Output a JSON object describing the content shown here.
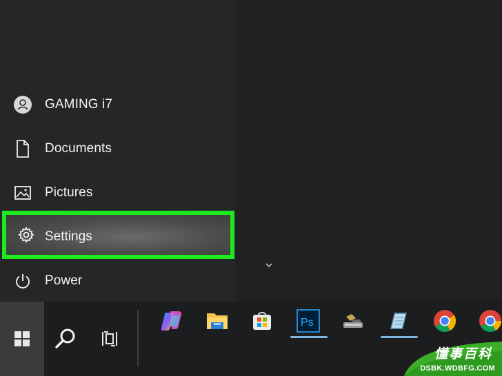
{
  "start_menu": {
    "items": [
      {
        "label": "GAMING i7",
        "icon": "user-icon"
      },
      {
        "label": "Documents",
        "icon": "document-icon"
      },
      {
        "label": "Pictures",
        "icon": "pictures-icon"
      },
      {
        "label": "Settings",
        "icon": "gear-icon",
        "highlighted": true
      },
      {
        "label": "Power",
        "icon": "power-icon"
      }
    ],
    "highlight_color": "#1ee81e"
  },
  "taskbar": {
    "buttons": [
      "windows-start-icon",
      "search-icon",
      "task-view-icon"
    ],
    "apps": [
      {
        "name": "Copilot",
        "icon": "copilot-icon",
        "active": false
      },
      {
        "name": "File Explorer",
        "icon": "file-explorer-icon",
        "active": false
      },
      {
        "name": "Microsoft Store",
        "icon": "store-icon",
        "active": false
      },
      {
        "name": "Photoshop",
        "icon": "photoshop-icon",
        "label": "Ps",
        "active": true
      },
      {
        "name": "Tool",
        "icon": "wrench-tool-icon",
        "active": false
      },
      {
        "name": "Notes",
        "icon": "notes-app-icon",
        "active": true
      },
      {
        "name": "Chrome",
        "icon": "chrome-icon",
        "active": false
      },
      {
        "name": "Chrome 2",
        "icon": "chrome-icon",
        "active": false
      }
    ]
  },
  "watermark": {
    "title": "懂事百科",
    "url": "DSBK.WDBFG.COM"
  }
}
